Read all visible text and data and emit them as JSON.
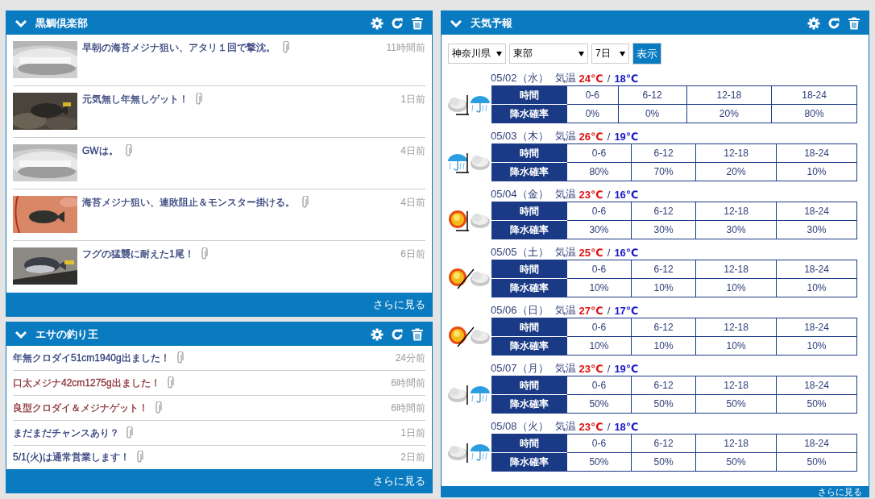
{
  "panels_left": [
    {
      "title": "黒鯛倶楽部",
      "kind": "thumbs",
      "more": "さらに見る",
      "items": [
        {
          "title": "早朝の海苔メジナ狙い、アタリ１回で撃沈。",
          "time": "11時間前"
        },
        {
          "title": "元気無し年無しゲット！",
          "time": "1日前"
        },
        {
          "title": "GWは。",
          "time": "4日前"
        },
        {
          "title": "海苔メジナ狙い、連敗阻止＆モンスター掛ける。",
          "time": "4日前"
        },
        {
          "title": "フグの猛襲に耐えた1尾！",
          "time": "6日前"
        }
      ]
    },
    {
      "title": "エサの釣り王",
      "kind": "list",
      "more": "さらに見る",
      "items": [
        {
          "title": "年無クロダイ51cm1940g出ました！",
          "time": "24分前",
          "color": "#2e3d78"
        },
        {
          "title": "口太メジナ42cm1275g出ました！",
          "time": "6時間前",
          "color": "#8a2f36"
        },
        {
          "title": "良型クロダイ＆メジナゲット！",
          "time": "6時間前",
          "color": "#8a2f36"
        },
        {
          "title": "まだまだチャンスあり？",
          "time": "1日前",
          "color": "#2e3d78"
        },
        {
          "title": "5/1(火)は通常営業します！",
          "time": "2日前",
          "color": "#2e3d78"
        }
      ]
    }
  ],
  "weather": {
    "title": "天気予報",
    "selects": [
      {
        "value": "神奈川県"
      },
      {
        "value": "東部"
      },
      {
        "value": "7日"
      }
    ],
    "show_button": "表示",
    "more": "さらに見る",
    "days": [
      {
        "date": "05/02（水）",
        "temp_label": "気温",
        "high": "24℃",
        "separator": "/",
        "low": "18℃",
        "icon": {
          "kind": "cloud-later-rain"
        },
        "row_labels": [
          "時間",
          "降水確率"
        ],
        "periods": [
          "0-6",
          "6-12",
          "12-18",
          "18-24"
        ],
        "chances": [
          "0%",
          "0%",
          "20%",
          "80%"
        ]
      },
      {
        "date": "05/03（木）",
        "temp_label": "気温",
        "high": "26℃",
        "separator": "/",
        "low": "19℃",
        "icon": {
          "kind": "rain-later-cloud"
        },
        "row_labels": [
          "時間",
          "降水確率"
        ],
        "periods": [
          "0-6",
          "6-12",
          "12-18",
          "18-24"
        ],
        "chances": [
          "80%",
          "70%",
          "20%",
          "10%"
        ]
      },
      {
        "date": "05/04（金）",
        "temp_label": "気温",
        "high": "23℃",
        "separator": "/",
        "low": "16℃",
        "icon": {
          "kind": "sun-later-cloud"
        },
        "row_labels": [
          "時間",
          "降水確率"
        ],
        "periods": [
          "0-6",
          "6-12",
          "12-18",
          "18-24"
        ],
        "chances": [
          "30%",
          "30%",
          "30%",
          "30%"
        ]
      },
      {
        "date": "05/05（土）",
        "temp_label": "気温",
        "high": "25℃",
        "separator": "/",
        "low": "16℃",
        "icon": {
          "kind": "sun-or-cloud"
        },
        "row_labels": [
          "時間",
          "降水確率"
        ],
        "periods": [
          "0-6",
          "6-12",
          "12-18",
          "18-24"
        ],
        "chances": [
          "10%",
          "10%",
          "10%",
          "10%"
        ]
      },
      {
        "date": "05/06（日）",
        "temp_label": "気温",
        "high": "27℃",
        "separator": "/",
        "low": "17℃",
        "icon": {
          "kind": "sun-or-cloud"
        },
        "row_labels": [
          "時間",
          "降水確率"
        ],
        "periods": [
          "0-6",
          "6-12",
          "12-18",
          "18-24"
        ],
        "chances": [
          "10%",
          "10%",
          "10%",
          "10%"
        ]
      },
      {
        "date": "05/07（月）",
        "temp_label": "気温",
        "high": "23℃",
        "separator": "/",
        "low": "19℃",
        "icon": {
          "kind": "cloud-sometimes-rain"
        },
        "row_labels": [
          "時間",
          "降水確率"
        ],
        "periods": [
          "0-6",
          "6-12",
          "12-18",
          "18-24"
        ],
        "chances": [
          "50%",
          "50%",
          "50%",
          "50%"
        ]
      },
      {
        "date": "05/08（火）",
        "temp_label": "気温",
        "high": "23℃",
        "separator": "/",
        "low": "18℃",
        "icon": {
          "kind": "cloud-sometimes-rain"
        },
        "row_labels": [
          "時間",
          "降水確率"
        ],
        "periods": [
          "0-6",
          "6-12",
          "12-18",
          "18-24"
        ],
        "chances": [
          "50%",
          "50%",
          "50%",
          "50%"
        ]
      }
    ]
  }
}
